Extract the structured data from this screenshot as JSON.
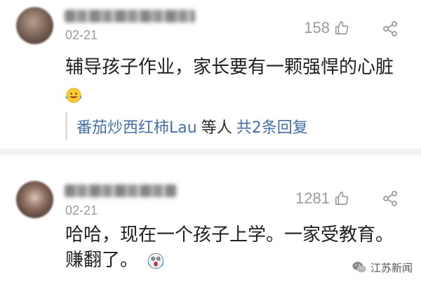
{
  "comments": [
    {
      "date": "02-21",
      "likes": "158",
      "text": "辅导孩子作业，家长要有一颗强悍的心脏",
      "emoji": "grinning-face-emoji",
      "reply": {
        "names": "番茄炒西红柿Lau",
        "etc": "等人",
        "count": "共2条回复"
      }
    },
    {
      "date": "02-21",
      "likes": "1281",
      "text_line1": "哈哈，现在一个孩子上学。一家受教育。",
      "text_line2": "赚翻了。",
      "emoji": "screaming-face-emoji"
    }
  ],
  "watermark": {
    "text": "江苏新闻"
  },
  "icons": {
    "like": "thumbs-up-icon",
    "share": "share-icon",
    "watermark": "wechat-logo-icon"
  },
  "colors": {
    "link": "#466fa5",
    "muted": "#9a9a9a",
    "text": "#1f1f1f"
  }
}
